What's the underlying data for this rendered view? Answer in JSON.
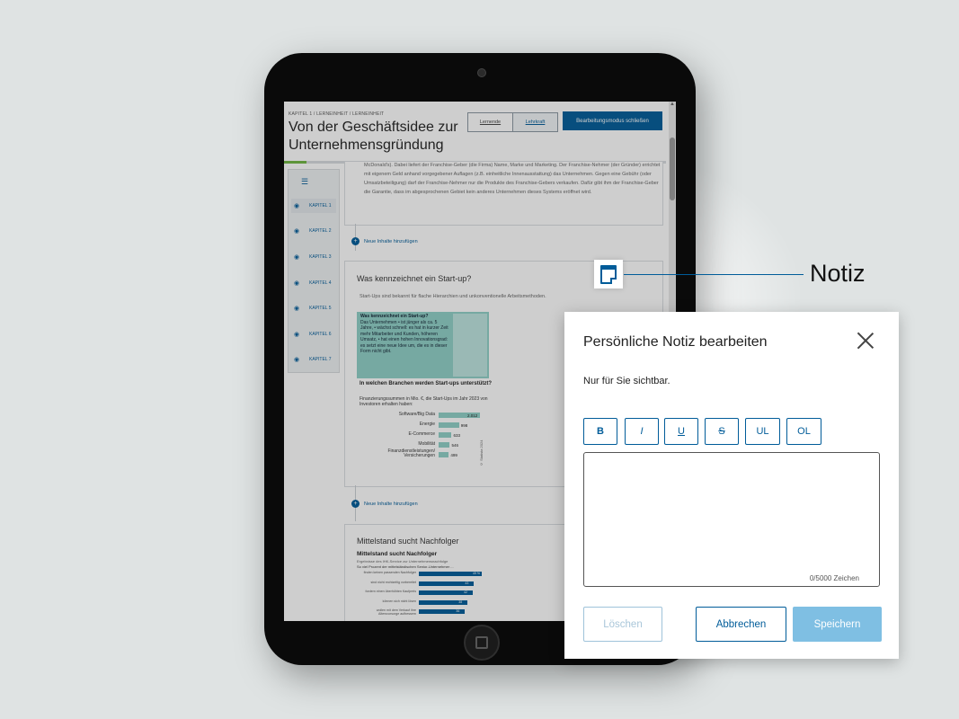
{
  "screen": {
    "breadcrumb": "KAPITEL 1 / LERNEINHEIT / LERNEINHEIT",
    "title": "Von der Geschäftsidee zur Unternehmensgründung",
    "mode_toggle": {
      "left": "Lernende",
      "right": "Lehrkraft"
    },
    "edit_close_label": "Bearbeitungsmodus schließen",
    "sidebar": {
      "chapters": [
        "KAPITEL 1",
        "KAPITEL 2",
        "KAPITEL 3",
        "KAPITEL 4",
        "KAPITEL 5",
        "KAPITEL 6",
        "KAPITEL 7"
      ]
    },
    "paragraph": "McDonald's). Dabei liefert der Franchise-Geber (die Firma) Name, Marke und Marketing. Der Franchise-Nehmer (der Gründer) errichtet mit eigenem Geld anhand vorgegebener Auflagen (z.B. einheitliche Innenausstattung) das Unternehmen. Gegen eine Gebühr (oder Umsatzbeteiligung) darf der Franchise-Nehmer nur die Produkte des Franchise-Gebers verkaufen. Dafür gibt ihm der Franchise-Geber die Garantie, dass im abgesprochenen Gebiet kein anderes Unternehmen dieses Systems eröffnet wird.",
    "add_content_label": "Neue Inhalte hinzufügen",
    "card1": {
      "title": "Was kennzeichnet ein Start-up?",
      "subtitle": "Start-Ups sind bekannt für flache Hierarchien und unkonventionelle Arbeitsmethoden.",
      "infobox_title": "Was kennzeichnet ein Start-up?",
      "infobox_text": "Das Unternehmen • ist jünger als ca. 5 Jahre, • wächst schnell: es hat in kurzer Zeit mehr Mitarbeiter und Kunden, höheren Umsatz, • hat einen hohen Innovationsgrad: es setzt eine neue Idee um, die es in dieser Form nicht gibt.",
      "chart_title": "In welchen Branchen werden Start-ups unterstützt?",
      "chart_sub": "Finanzierungssummen in Mio. €, die Start-Ups im Jahr 2023 von Investoren erhalten haben:",
      "source": "© Statista 2024"
    },
    "card2": {
      "title": "Mittelstand sucht Nachfolger",
      "chart_title": "Mittelstand sucht Nachfolger",
      "chart_sub": "Ergebnisse des IHK-Service zur Unternehmensnachfolge",
      "chart_sub2": "So viel Prozent der mittelständischen Senior-Unternehmer ...",
      "rows": [
        "finden keinen passenden Nachfolger",
        "sind nicht rechtzeitig vorbereitet",
        "fordern einen überhöhten Kaufpreis",
        "können sich nicht lösen",
        "wollen mit dem Verkauf ihre Altersvorsorge aufbessern"
      ],
      "values": [
        "49 %",
        "43",
        "42",
        "38",
        "36"
      ]
    }
  },
  "chart_data": [
    {
      "type": "bar",
      "title": "In welchen Branchen werden Start-ups unterstützt?",
      "categories": [
        "Software/Big Data",
        "Energie",
        "E-Commerce",
        "Mobilität",
        "Finanzdienstleistungen/ Versicherungen"
      ],
      "values": [
        2012,
        998,
        633,
        546,
        499
      ],
      "ylim": [
        0,
        2100
      ]
    },
    {
      "type": "bar",
      "title": "Mittelstand sucht Nachfolger",
      "categories": [
        "finden keinen passenden Nachfolger",
        "sind nicht rechtzeitig vorbereitet",
        "fordern einen überhöhten Kaufpreis",
        "können sich nicht lösen",
        "wollen mit dem Verkauf ihre Altersvorsorge aufbessern"
      ],
      "values": [
        49,
        43,
        42,
        38,
        36
      ]
    }
  ],
  "callout": {
    "label": "Notiz"
  },
  "modal": {
    "title": "Persönliche Notiz bearbeiten",
    "subtitle": "Nur für Sie sichtbar.",
    "format_buttons": [
      "B",
      "I",
      "U",
      "S",
      "UL",
      "OL"
    ],
    "counter": "0/5000 Zeichen",
    "delete_label": "Löschen",
    "cancel_label": "Abbrechen",
    "save_label": "Speichern"
  },
  "colors": {
    "accent": "#005c99",
    "save_disabled": "#7fbfe3",
    "teal": "#8fd0c7",
    "progress": "#6fb542"
  }
}
